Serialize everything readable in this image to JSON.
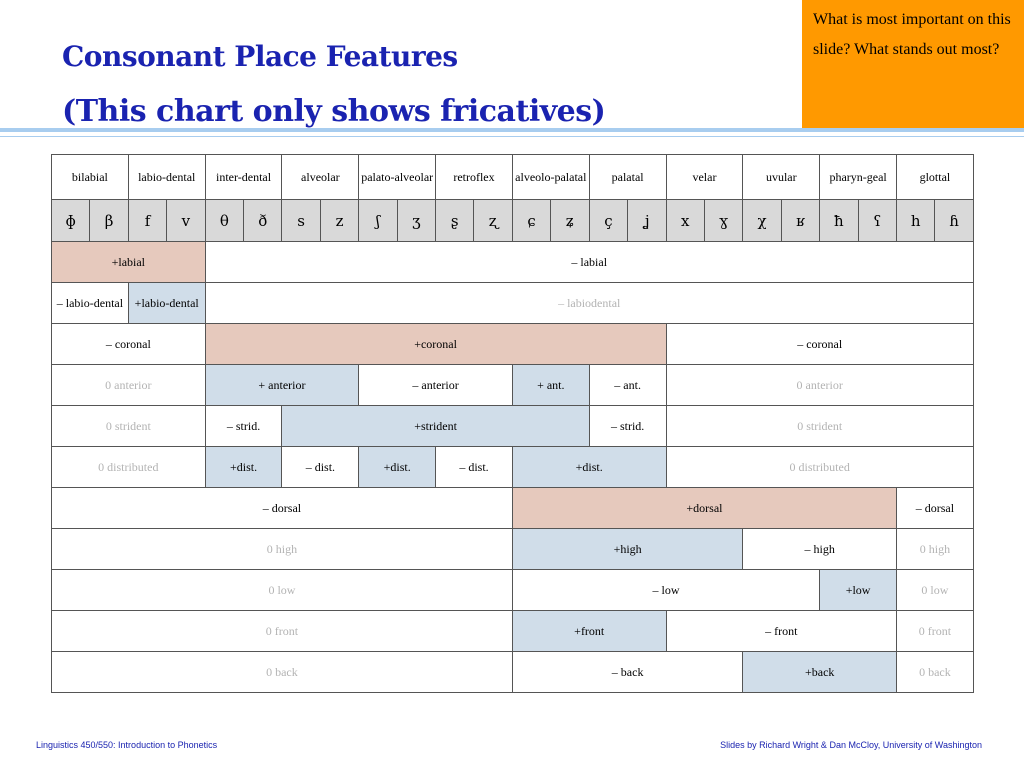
{
  "slide": {
    "title_line1": "Consonant Place Features",
    "title_line2": "(This chart only shows fricatives)",
    "note": "What is most important on this slide?  What stands out most?",
    "colors": {
      "title": "#1a23b0",
      "note_bg": "#ff9900",
      "rule": "#a8cdef",
      "plus_major": "#e6c9bd",
      "plus_minor": "#d0dde9"
    }
  },
  "table": {
    "places": [
      "bilabial",
      "labio-dental",
      "inter-dental",
      "alveolar",
      "palato-alveolar",
      "retroflex",
      "alveolo-palatal",
      "palatal",
      "velar",
      "uvular",
      "pharyn-geal",
      "glottal"
    ],
    "symbols": [
      "ɸ",
      "β",
      "f",
      "v",
      "θ",
      "ð",
      "s",
      "z",
      "ʃ",
      "ʒ",
      "ʂ",
      "ʐ",
      "ɕ",
      "ʑ",
      "ç",
      "ʝ",
      "x",
      "ɣ",
      "χ",
      "ʁ",
      "ħ",
      "ʕ",
      "h",
      "ɦ"
    ],
    "rows": [
      {
        "name": "labial",
        "cells": [
          {
            "text": "+labial",
            "span": 4,
            "style": "pink"
          },
          {
            "text": "– labial",
            "span": 20,
            "style": ""
          }
        ]
      },
      {
        "name": "labiodental",
        "cells": [
          {
            "text": "– labio-dental",
            "span": 2,
            "style": ""
          },
          {
            "text": "+labio-dental",
            "span": 2,
            "style": "blue"
          },
          {
            "text": "– labiodental",
            "span": 20,
            "style": "gray"
          }
        ]
      },
      {
        "name": "coronal",
        "cells": [
          {
            "text": "– coronal",
            "span": 4,
            "style": ""
          },
          {
            "text": "+coronal",
            "span": 12,
            "style": "pink"
          },
          {
            "text": "– coronal",
            "span": 8,
            "style": ""
          }
        ]
      },
      {
        "name": "anterior",
        "cells": [
          {
            "text": "0 anterior",
            "span": 4,
            "style": "gray"
          },
          {
            "text": "+ anterior",
            "span": 4,
            "style": "blue"
          },
          {
            "text": "– anterior",
            "span": 4,
            "style": ""
          },
          {
            "text": "+ ant.",
            "span": 2,
            "style": "blue"
          },
          {
            "text": "– ant.",
            "span": 2,
            "style": ""
          },
          {
            "text": "0 anterior",
            "span": 8,
            "style": "gray"
          }
        ]
      },
      {
        "name": "strident",
        "cells": [
          {
            "text": "0 strident",
            "span": 4,
            "style": "gray"
          },
          {
            "text": "– strid.",
            "span": 2,
            "style": ""
          },
          {
            "text": "+strident",
            "span": 8,
            "style": "blue"
          },
          {
            "text": "– strid.",
            "span": 2,
            "style": ""
          },
          {
            "text": "0 strident",
            "span": 8,
            "style": "gray"
          }
        ]
      },
      {
        "name": "distributed",
        "cells": [
          {
            "text": "0 distributed",
            "span": 4,
            "style": "gray"
          },
          {
            "text": "+dist.",
            "span": 2,
            "style": "blue"
          },
          {
            "text": "– dist.",
            "span": 2,
            "style": ""
          },
          {
            "text": "+dist.",
            "span": 2,
            "style": "blue"
          },
          {
            "text": "– dist.",
            "span": 2,
            "style": ""
          },
          {
            "text": "+dist.",
            "span": 4,
            "style": "blue"
          },
          {
            "text": "0 distributed",
            "span": 8,
            "style": "gray"
          }
        ]
      },
      {
        "name": "dorsal",
        "cells": [
          {
            "text": "– dorsal",
            "span": 12,
            "style": ""
          },
          {
            "text": "+dorsal",
            "span": 10,
            "style": "pink"
          },
          {
            "text": "– dorsal",
            "span": 2,
            "style": ""
          }
        ]
      },
      {
        "name": "high",
        "cells": [
          {
            "text": "0 high",
            "span": 12,
            "style": "gray"
          },
          {
            "text": "+high",
            "span": 6,
            "style": "blue"
          },
          {
            "text": "– high",
            "span": 4,
            "style": ""
          },
          {
            "text": "0 high",
            "span": 2,
            "style": "gray"
          }
        ]
      },
      {
        "name": "low",
        "cells": [
          {
            "text": "0 low",
            "span": 12,
            "style": "gray"
          },
          {
            "text": "– low",
            "span": 8,
            "style": ""
          },
          {
            "text": "+low",
            "span": 2,
            "style": "blue"
          },
          {
            "text": "0 low",
            "span": 2,
            "style": "gray"
          }
        ]
      },
      {
        "name": "front",
        "cells": [
          {
            "text": "0 front",
            "span": 12,
            "style": "gray"
          },
          {
            "text": "+front",
            "span": 4,
            "style": "blue"
          },
          {
            "text": "– front",
            "span": 6,
            "style": ""
          },
          {
            "text": "0 front",
            "span": 2,
            "style": "gray"
          }
        ]
      },
      {
        "name": "back",
        "cells": [
          {
            "text": "0 back",
            "span": 12,
            "style": "gray"
          },
          {
            "text": "– back",
            "span": 6,
            "style": ""
          },
          {
            "text": "+back",
            "span": 4,
            "style": "blue"
          },
          {
            "text": "0 back",
            "span": 2,
            "style": "gray"
          }
        ]
      }
    ]
  },
  "footer": {
    "left": "Linguistics 450/550: Introduction to Phonetics",
    "right": "Slides by Richard Wright & Dan McCloy, University of Washington"
  }
}
